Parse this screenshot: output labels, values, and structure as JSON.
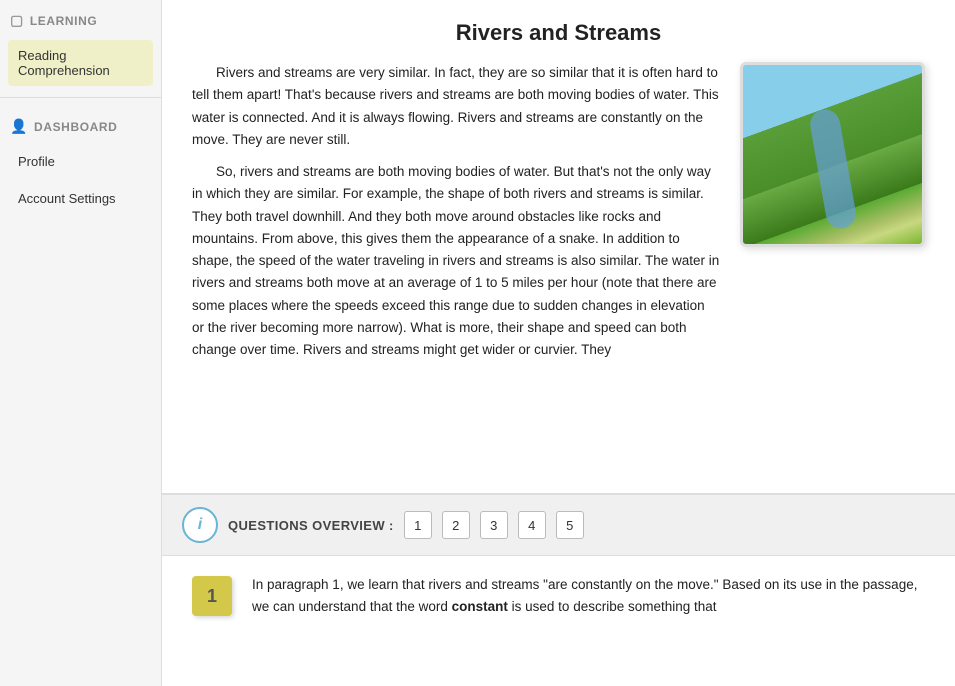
{
  "sidebar": {
    "learning_header": "LEARNING",
    "dashboard_header": "DASHBOARD",
    "nav_items": [
      {
        "id": "reading-comprehension",
        "label": "Reading Comprehension",
        "active": true
      },
      {
        "id": "profile",
        "label": "Profile",
        "active": false
      },
      {
        "id": "account-settings",
        "label": "Account Settings",
        "active": false
      }
    ]
  },
  "passage": {
    "title": "Rivers and Streams",
    "paragraphs": [
      "Rivers and streams are very similar. In fact, they are so similar that it is often hard to tell them apart! That's because rivers and streams are both moving bodies of water. This water is connected. And it is always flowing. Rivers and streams are constantly on the move. They are never still.",
      "So, rivers and streams are both moving bodies of water. But that's not the only way in which they are similar. For example, the shape of both rivers and streams is similar. They both travel downhill. And they both move around obstacles like rocks and mountains. From above, this gives them the appearance of a snake. In addition to shape, the speed of the water traveling in rivers and streams is also similar. The water in rivers and streams both move at an average of 1 to 5 miles per hour (note that there are some places where the speeds exceed this range due to sudden changes in elevation or the river becoming more narrow). What is more, their shape and speed can both change over time. Rivers and streams might get wider or curvier. They"
    ],
    "image_alt": "Aerial view of a river winding through green landscape"
  },
  "questions_bar": {
    "label": "QUESTIONS OVERVIEW :",
    "info_icon": "i",
    "question_numbers": [
      "1",
      "2",
      "3",
      "4",
      "5"
    ]
  },
  "question": {
    "number": "1",
    "text_before_bold": "In paragraph 1, we learn that rivers and streams \"are constantly on the move.\" Based on its use in the passage, we can understand that the word ",
    "bold_word": "constant",
    "text_after_bold": " is used to describe something that"
  }
}
